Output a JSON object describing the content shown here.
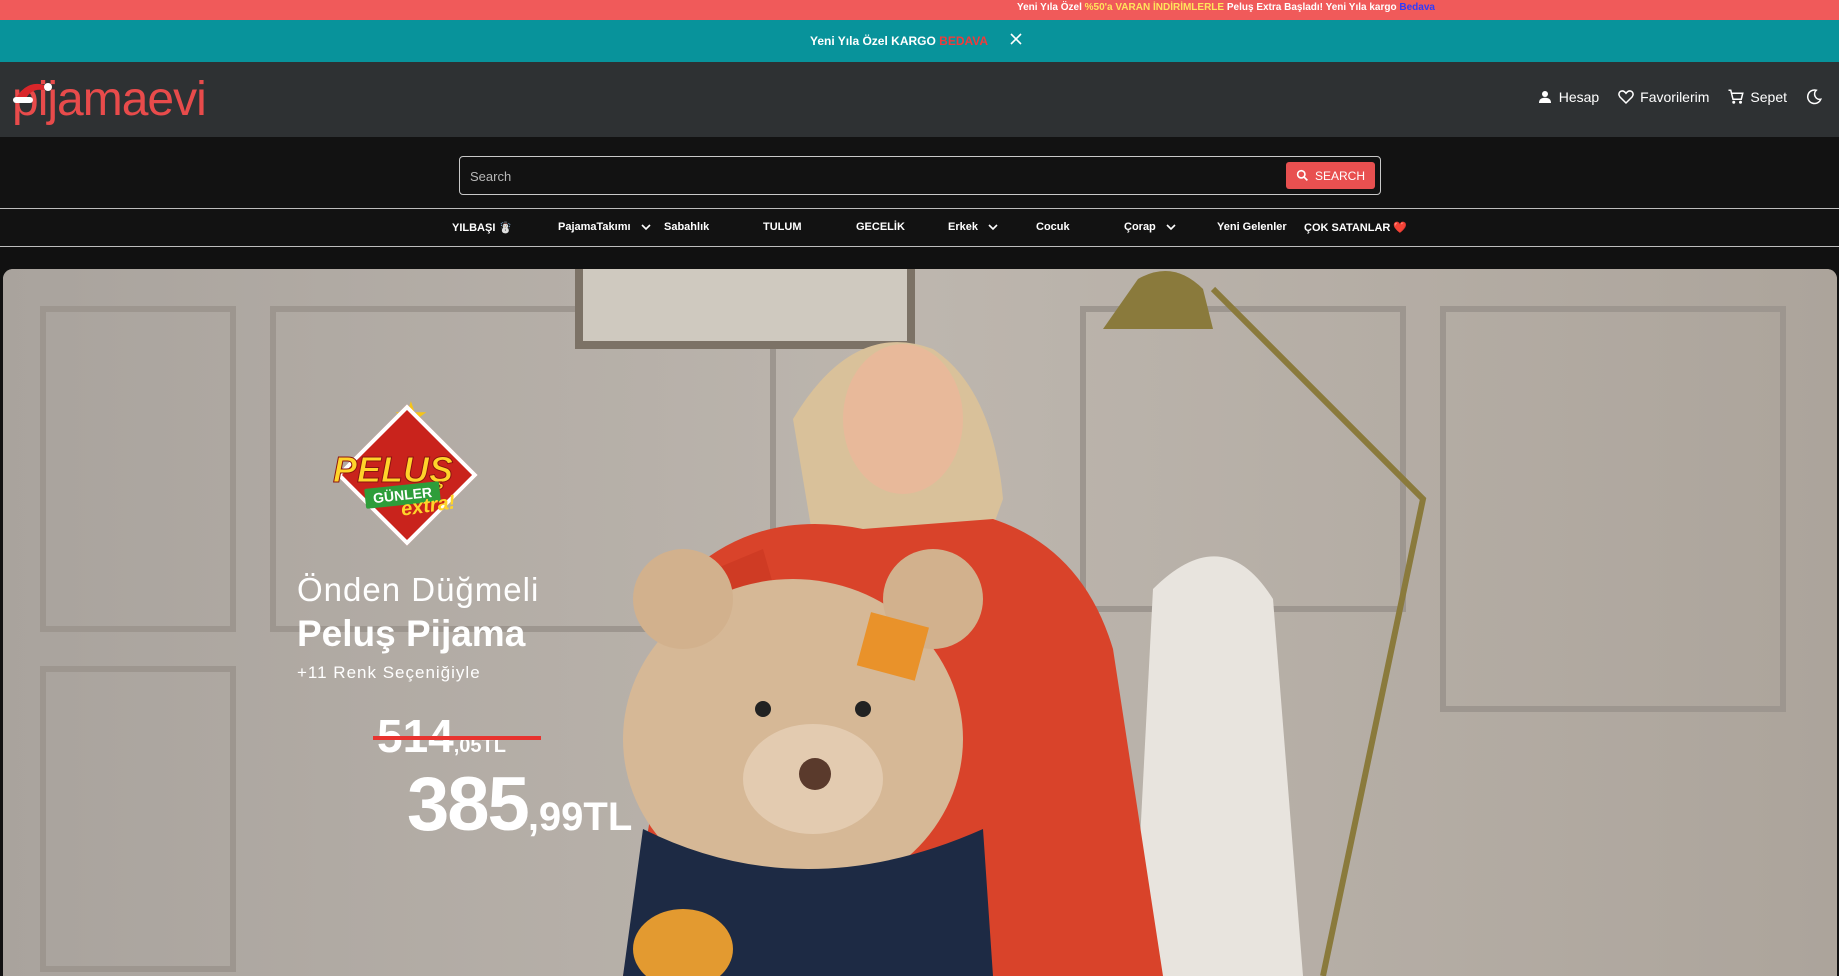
{
  "topbar": {
    "part1": "Yeni Yıla Özel ",
    "highlight": "%50'a VARAN İNDİRİMLERLE",
    "part2": " Peluş Extra Başladı!  Yeni Yıla kargo ",
    "link": "Bedava"
  },
  "promo": {
    "text": "Yeni Yıla Özel KARGO ",
    "highlight": "BEDAVA"
  },
  "header": {
    "logo": "pijamaevi",
    "links": [
      {
        "label": "Hesap",
        "icon": "person-icon"
      },
      {
        "label": "Favorilerim",
        "icon": "heart-icon"
      },
      {
        "label": "Sepet",
        "icon": "cart-icon"
      },
      {
        "icon": "moon-icon"
      }
    ]
  },
  "search": {
    "placeholder": "Search",
    "button_label": "SEARCH"
  },
  "nav": {
    "items": [
      {
        "label": "YILBAŞI ☃️"
      },
      {
        "label": "PajamaTakımı"
      },
      {
        "label": "Sabahlık"
      },
      {
        "label": "TULUM"
      },
      {
        "label": "GECELİK"
      },
      {
        "label": "Erkek"
      },
      {
        "label": "Cocuk"
      },
      {
        "label": "Çorap"
      },
      {
        "label": "Yeni Gelenler"
      },
      {
        "label": "ÇOK SATANLAR ❤️"
      }
    ]
  },
  "hero": {
    "badge_title": "PELUŞ",
    "badge_sub": "GÜNLER",
    "badge_extra": "extra!",
    "line1": "Önden Düğmeli",
    "line2": "Peluş Pijama",
    "line3": "+11 Renk Seçeniğiyle",
    "old_price_main": "514",
    "old_price_small": ",05TL",
    "new_price_main": "385",
    "new_price_small": ",99TL"
  },
  "colors": {
    "topbar": "#f05a5a",
    "promo": "#08939b",
    "header": "#2e3133",
    "accent": "#e85050"
  }
}
